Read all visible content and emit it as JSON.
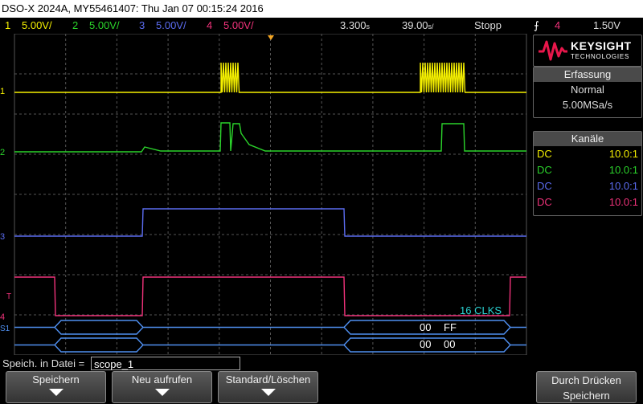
{
  "title": "DSO-X 2024A, MY55461407: Thu Jan 07 00:15:24 2016",
  "status": {
    "channels": [
      {
        "num": "1",
        "scale": "5.00V/",
        "color": "#f5f000"
      },
      {
        "num": "2",
        "scale": "5.00V/",
        "color": "#2bd42b"
      },
      {
        "num": "3",
        "scale": "5.00V/",
        "color": "#5b6cf0"
      },
      {
        "num": "4",
        "scale": "5.00V/",
        "color": "#f0327a"
      }
    ],
    "delay": "3.300",
    "delay_unit": "s",
    "timebase": "39.00",
    "timebase_unit": "s/",
    "run_state": "Stopp",
    "trigger_channel": "4",
    "trigger_level": "1.50V"
  },
  "brand": {
    "name": "KEYSIGHT",
    "sub": "TECHNOLOGIES",
    "color": "#e8174b"
  },
  "acquisition": {
    "title": "Erfassung",
    "mode": "Normal",
    "rate": "5.00MSa/s"
  },
  "channels_panel": {
    "title": "Kanäle",
    "rows": [
      {
        "coupling": "DC",
        "probe": "10.0:1",
        "color": "#f5f000"
      },
      {
        "coupling": "DC",
        "probe": "10.0:1",
        "color": "#2bd42b"
      },
      {
        "coupling": "DC",
        "probe": "10.0:1",
        "color": "#5b6cf0"
      },
      {
        "coupling": "DC",
        "probe": "10.0:1",
        "color": "#f0327a"
      }
    ]
  },
  "markers": {
    "ch1": "1",
    "ch2": "2",
    "ch3": "3",
    "ch4": "4",
    "trigger": "T",
    "serial": "S1"
  },
  "serial_decode": {
    "label": "16 CLKS",
    "row1": [
      "00",
      "FF"
    ],
    "row2": [
      "00",
      "00"
    ]
  },
  "file": {
    "label": "Speich. in Datei =",
    "value": "scope_1"
  },
  "softkeys": [
    {
      "label": "Speichern"
    },
    {
      "label": "Neu aufrufen"
    },
    {
      "label": "Standard/Löschen"
    },
    {
      "label": "Durch Drücken",
      "label2": "Speichern"
    }
  ]
}
